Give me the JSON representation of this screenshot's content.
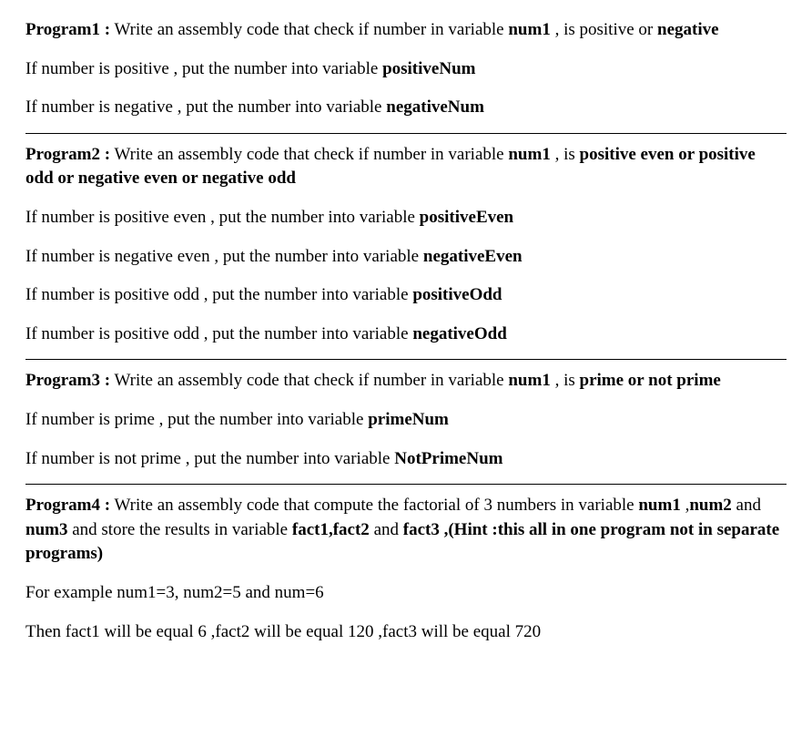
{
  "program1": {
    "title": "Program1 :",
    "desc1": " Write an assembly code that check if number in variable ",
    "var1": "num1",
    "desc2": " , is positive or ",
    "negative": "negative",
    "line2a": "If number is positive , put the number into variable ",
    "line2b": "positiveNum",
    "line3a": "If number is negative , put the number into variable ",
    "line3b": "negativeNum"
  },
  "program2": {
    "title": "Program2 :",
    "desc1": " Write an assembly code that check if number in variable ",
    "var1": "num1",
    "desc2": " , is ",
    "bold_tail": "positive even or positive odd or negative even or negative odd",
    "l1a": "If number is positive even  , put the number into variable ",
    "l1b": "positiveEven",
    "l2a": "If number is negative even , put the number into variable ",
    "l2b": "negativeEven",
    "l3a": "If number is positive odd  , put the number into variable ",
    "l3b": "positiveOdd",
    "l4a": "If number is positive odd  , put the number into variable ",
    "l4b": "negativeOdd"
  },
  "program3": {
    "title": " Program3 :",
    "desc1": " Write an assembly code that check if number in variable ",
    "var1": "num1",
    "desc2": " , is ",
    "bold_tail": "prime or  not prime",
    "l1a": "If number is prime , put the number into variable ",
    "l1b": "primeNum",
    "l2a": "If number is not prime , put the number into variable ",
    "l2b": "NotPrimeNum"
  },
  "program4": {
    "title": "Program4 :",
    "desc1": " Write an assembly code that compute the factorial of 3 numbers in variable ",
    "var1": "num1",
    "comma_space": " ,",
    "var2": "num2",
    "and1": " and ",
    "var3": "num3",
    "desc2": " and store the results in variable ",
    "fact_list": "fact1,fact2",
    "and2": " and ",
    "fact3": "fact3",
    "hint": " ,(Hint :this all in one program not in separate programs)",
    "ex1": "For example num1=3, num2=5 and num=6",
    "ex2": "Then fact1 will be equal  6 ,fact2 will be equal 120  ,fact3 will be equal  720"
  }
}
